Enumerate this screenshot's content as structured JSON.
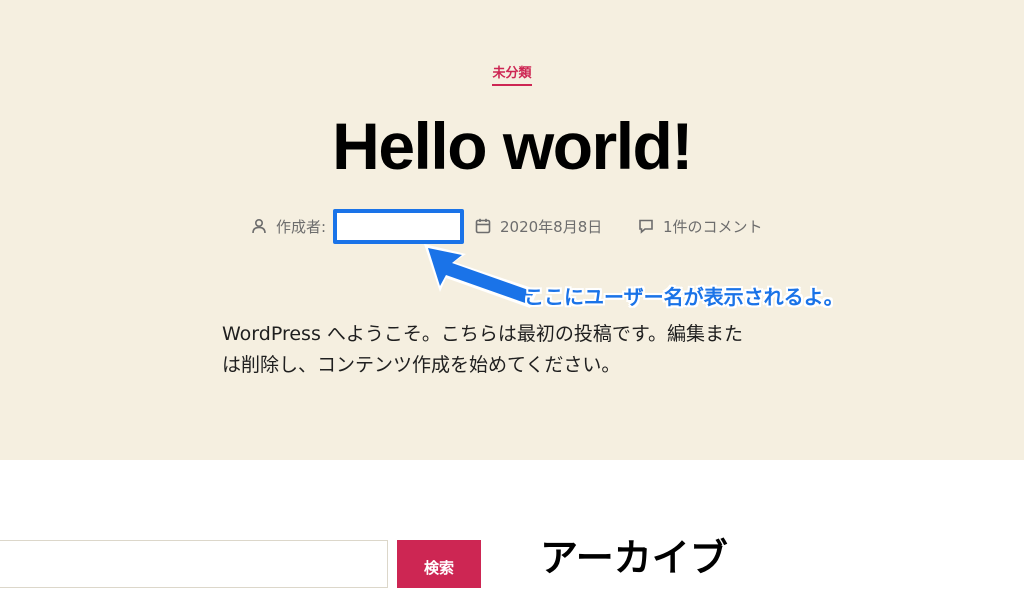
{
  "post": {
    "category": "未分類",
    "title": "Hello world!",
    "author_label": "作成者:",
    "date": "2020年8月8日",
    "comments": "1件のコメント",
    "content": [
      "WordPress へようこそ。こちらは最初の投稿です。編集また",
      "は削除し、コンテンツ作成を始めてください。"
    ]
  },
  "annotation": {
    "text": "ここにユーザー名が表示されるよ。",
    "color": "#1a73e8"
  },
  "sidebar": {
    "search_button_label": "検索",
    "search_placeholder": "",
    "widget_title": "アーカイブ"
  },
  "colors": {
    "accent": "#cd2653",
    "hero_background": "#f5efe0",
    "meta_text": "#6d6d6d"
  },
  "icons": [
    "user-icon",
    "calendar-icon",
    "comment-icon"
  ]
}
